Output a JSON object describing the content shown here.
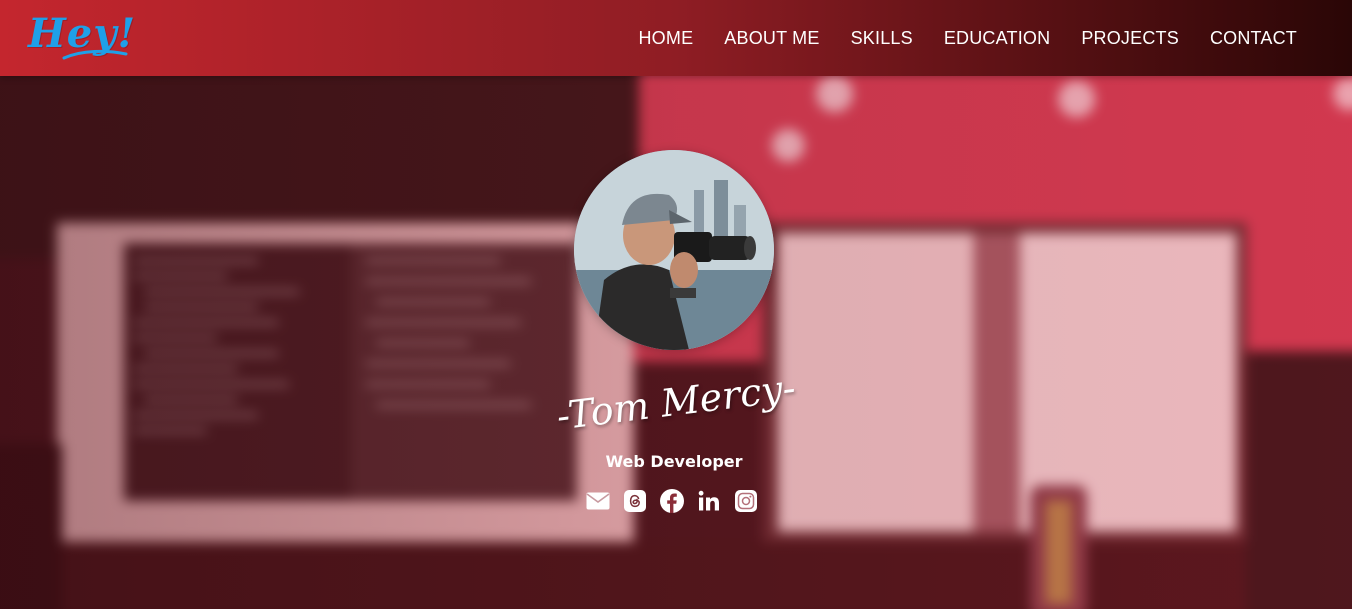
{
  "header": {
    "logo_text": "Hey!",
    "nav": [
      {
        "label": "HOME"
      },
      {
        "label": "ABOUT ME"
      },
      {
        "label": "SKILLS"
      },
      {
        "label": "EDUCATION"
      },
      {
        "label": "PROJECTS"
      },
      {
        "label": "CONTACT"
      }
    ]
  },
  "profile": {
    "name": "-Tom Mercy-",
    "role": "Web Developer",
    "socials": [
      {
        "icon": "envelope-icon"
      },
      {
        "icon": "threads-icon"
      },
      {
        "icon": "facebook-icon"
      },
      {
        "icon": "linkedin-icon"
      },
      {
        "icon": "instagram-icon"
      }
    ]
  },
  "colors": {
    "navbar_start": "#c4262e",
    "navbar_end": "#2a0606",
    "logo": "#1fa0e8",
    "text": "#ffffff"
  }
}
